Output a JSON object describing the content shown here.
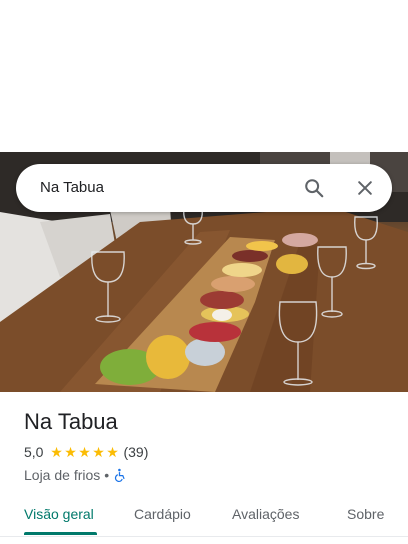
{
  "search": {
    "value": "Na Tabua",
    "search_icon": "search-icon",
    "close_icon": "close-icon"
  },
  "place": {
    "name": "Na Tabua",
    "rating": "5,0",
    "stars": 5,
    "reviews": "(39)",
    "category": "Loja de frios",
    "separator": "•",
    "accessibility_icon": "wheelchair-icon"
  },
  "tabs": [
    {
      "label": "Visão geral",
      "active": true
    },
    {
      "label": "Cardápio",
      "active": false
    },
    {
      "label": "Avaliações",
      "active": false
    },
    {
      "label": "Sobre",
      "active": false
    }
  ],
  "colors": {
    "accent": "#00796b",
    "star": "#fbbc04"
  }
}
